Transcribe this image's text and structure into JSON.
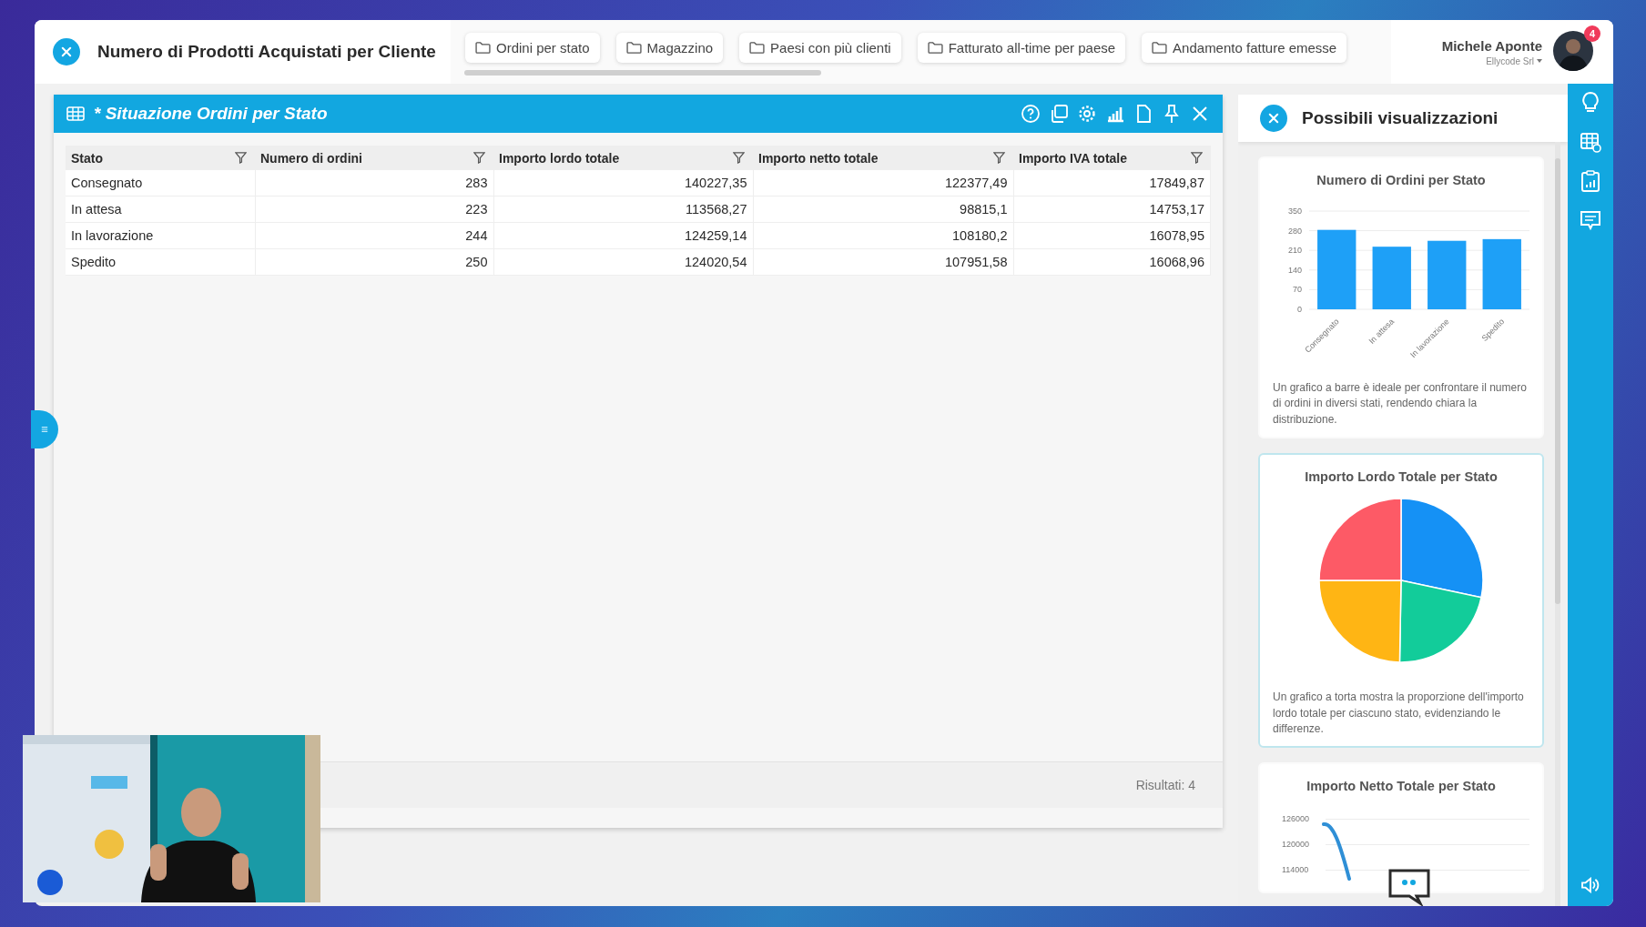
{
  "app_bar": {
    "title": "Numero di Prodotti Acquistati per Cliente",
    "tabs": [
      {
        "label": "Ordini per stato"
      },
      {
        "label": "Magazzino"
      },
      {
        "label": "Paesi con più clienti"
      },
      {
        "label": "Fatturato all-time per paese"
      },
      {
        "label": "Andamento fatture emesse"
      }
    ],
    "user": {
      "name": "Michele Aponte",
      "company": "Ellycode Srl",
      "notifications": "4"
    }
  },
  "panel": {
    "title": "* Situazione Ordini per Stato",
    "columns": [
      "Stato",
      "Numero di ordini",
      "Importo lordo totale",
      "Importo netto totale",
      "Importo IVA totale"
    ],
    "rows": [
      [
        "Consegnato",
        "283",
        "140227,35",
        "122377,49",
        "17849,87"
      ],
      [
        "In attesa",
        "223",
        "113568,27",
        "98815,1",
        "14753,17"
      ],
      [
        "In lavorazione",
        "244",
        "124259,14",
        "108180,2",
        "16078,95"
      ],
      [
        "Spedito",
        "250",
        "124020,54",
        "107951,58",
        "16068,96"
      ]
    ],
    "results": "Risultati: 4"
  },
  "suggestions": {
    "title": "Possibili visualizzazioni",
    "cards": [
      {
        "kind": "bar",
        "title": "Numero di Ordini per Stato",
        "chart_data": {
          "type": "bar",
          "categories": [
            "Consegnato",
            "In attesa",
            "In lavorazione",
            "Spedito"
          ],
          "values": [
            283,
            223,
            244,
            250
          ],
          "ylim": [
            0,
            350
          ],
          "grid": true,
          "yticks": [
            0,
            70,
            140,
            210,
            280,
            350
          ]
        },
        "description": "Un grafico a barre è ideale per confrontare il numero di ordini in diversi stati, rendendo chiara la distribuzione.",
        "highlighted": false
      },
      {
        "kind": "pie",
        "title": "Importo Lordo Totale per Stato",
        "description": "Un grafico a torta mostra la proporzione dell'importo lordo totale per ciascuno stato, evidenziando le differenze.",
        "highlighted": true
      },
      {
        "kind": "line",
        "title": "Importo Netto Totale per Stato",
        "axis_labels": [
          "126000",
          "120000",
          "114000"
        ],
        "highlighted": false
      }
    ]
  }
}
